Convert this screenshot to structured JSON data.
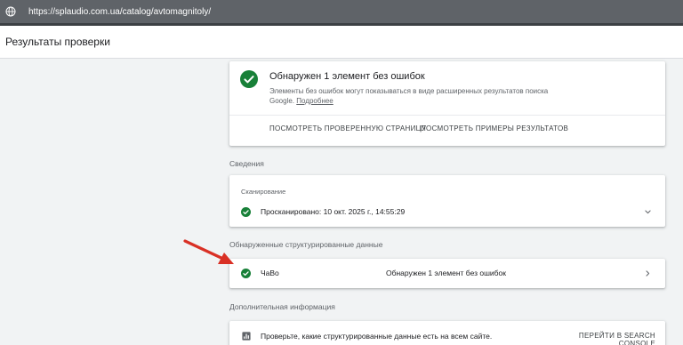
{
  "browser": {
    "url": "https://splaudio.com.ua/catalog/avtomagnitoly/",
    "icon": "globe-icon"
  },
  "header": {
    "title": "Результаты проверки"
  },
  "result": {
    "title": "Обнаружен 1 элемент без ошибок",
    "description": "Элементы без ошибок могут показываться в виде расширенных результатов поиска Google.",
    "link": "Подробнее",
    "button_view_page": "ПОСМОТРЕТЬ ПРОВЕРЕННУЮ СТРАНИЦУ",
    "button_view_examples": "ПОСМОТРЕТЬ ПРИМЕРЫ РЕЗУЛЬТАТОВ"
  },
  "details": {
    "section_label": "Сведения",
    "scan_title": "Сканирование",
    "scan_status": "Просканировано: 10 окт. 2025 г., 14:55:29"
  },
  "structured": {
    "section_label": "Обнаруженные структурированные данные",
    "items": [
      {
        "name": "ЧаВо",
        "status": "Обнаружен 1 элемент без ошибок"
      }
    ]
  },
  "more": {
    "section_label": "Дополнительная информация",
    "text": "Проверьте, какие структурированные данные есть на всем сайте.",
    "button": "ПЕРЕЙТИ В SEARCH CONSOLE"
  },
  "colors": {
    "success": "#188038",
    "annotation_arrow": "#d93025",
    "urlbar": "#5f6368"
  }
}
